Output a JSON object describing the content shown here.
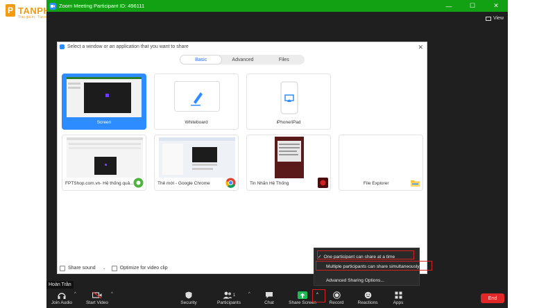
{
  "watermark": {
    "brand": "TANPHAT",
    "mark": "P",
    "tagline": "Trao giá trị - Tạo niềm tin"
  },
  "window": {
    "title": "Zoom Meeting Participant ID: 496111",
    "view_label": "View",
    "controls": {
      "minimize": "—",
      "maximize": "☐",
      "close": "✕"
    }
  },
  "dialog": {
    "title": "Select a window or an application that you want to share",
    "close": "✕",
    "tabs": [
      {
        "label": "Basic",
        "active": true
      },
      {
        "label": "Advanced",
        "active": false
      },
      {
        "label": "Files",
        "active": false
      }
    ],
    "tiles": [
      {
        "label": "Screen",
        "selected": true
      },
      {
        "label": "Whiteboard",
        "selected": false
      },
      {
        "label": "iPhone/iPad",
        "selected": false
      },
      {
        "label": "FPTShop.com.vn- Hệ thống quả...",
        "selected": false
      },
      {
        "label": "Thẻ mới - Google Chrome",
        "selected": false
      },
      {
        "label": "Tin Nhắn Hệ Thống",
        "selected": false
      },
      {
        "label": "File Explorer",
        "selected": false
      }
    ],
    "share_sound": "Share sound",
    "optimize": "Optimize for video clip"
  },
  "popup": {
    "items": [
      {
        "label": "One participant can share at a time",
        "checked": true
      },
      {
        "label": "Multiple participants can share simultaneously",
        "checked": false
      },
      {
        "label": "Advanced Sharing Options...",
        "checked": false
      }
    ],
    "check": "✓"
  },
  "user_name": "Hoàn Trần",
  "toolbar": {
    "join_audio": "Join Audio",
    "start_video": "Start Video",
    "security": "Security",
    "participants": "Participants",
    "participants_count": "1",
    "chat": "Chat",
    "share_screen": "Share Screen",
    "record": "Record",
    "reactions": "Reactions",
    "apps": "Apps",
    "end": "End"
  },
  "colors": {
    "titlebar": "#12a112",
    "accent": "#2d8cff",
    "share": "#1fb955",
    "end": "#e02828",
    "highlight": "#d32020"
  }
}
